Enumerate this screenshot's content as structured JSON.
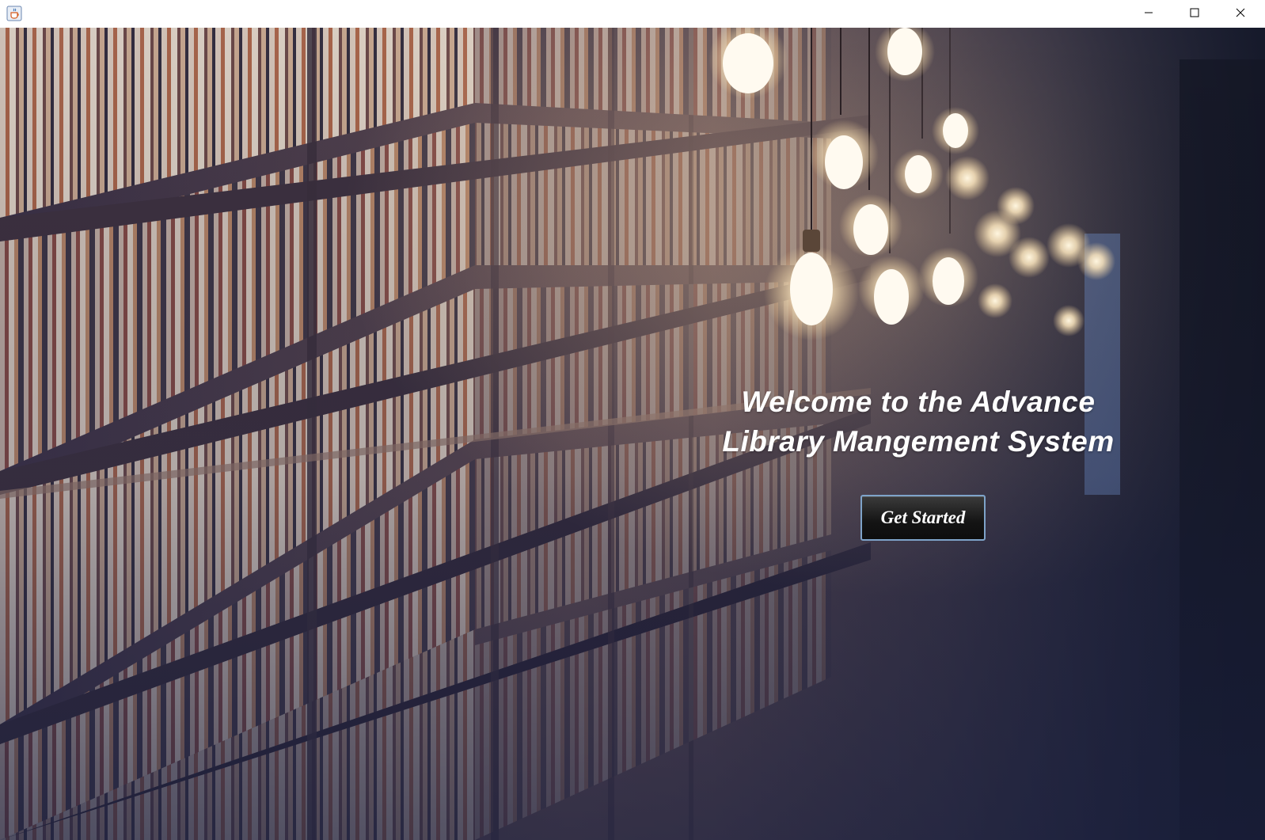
{
  "window": {
    "icon": "java-cup-icon",
    "controls": {
      "minimize_icon": "minimize-icon",
      "maximize_icon": "maximize-icon",
      "close_icon": "close-icon"
    }
  },
  "welcome": {
    "line1": "Welcome to the Advance",
    "line2": "Library Mangement System"
  },
  "get_started": {
    "label": "Get Started"
  },
  "colors": {
    "titlebar": "#ffffff",
    "button_border": "#7ea3c9",
    "button_bg": "#141414",
    "text": "#ffffff"
  }
}
